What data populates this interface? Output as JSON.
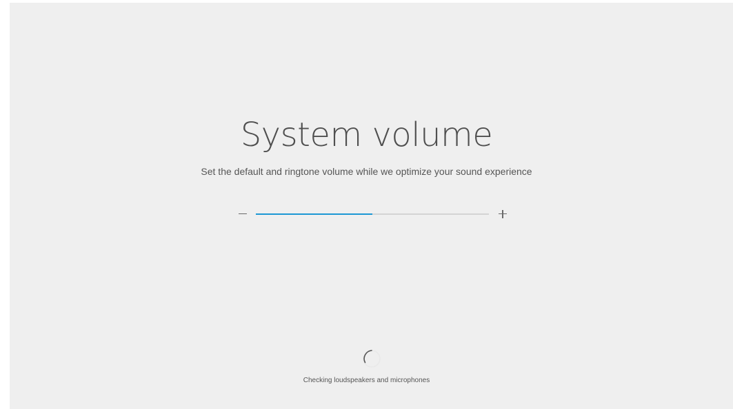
{
  "setup": {
    "title": "System volume",
    "subtitle": "Set the default and ringtone volume while we optimize your sound experience",
    "volume": {
      "level_fraction": 0.5,
      "decrease_symbol": "minus-icon",
      "increase_symbol": "plus-icon",
      "fill_color": "#1b97d4",
      "track_color": "#d4d4d4"
    },
    "status": {
      "text": "Checking loudspeakers and microphones",
      "icon": "loading-spinner-icon"
    }
  }
}
